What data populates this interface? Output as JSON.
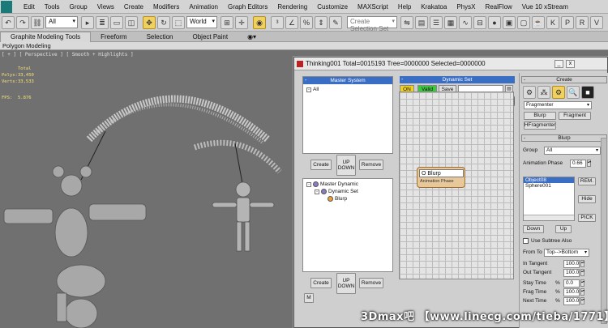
{
  "menu": [
    "Edit",
    "Tools",
    "Group",
    "Views",
    "Create",
    "Modifiers",
    "Animation",
    "Graph Editors",
    "Rendering",
    "Customize",
    "MAXScript",
    "Help",
    "Krakatoa",
    "PhysX",
    "RealFlow",
    "Vue 10 xStream"
  ],
  "toolbar": {
    "selection_filter": "All",
    "ref_coord": "World",
    "selection_set_placeholder": "Create Selection Set"
  },
  "ribbon": {
    "tabs": [
      "Graphite Modeling Tools",
      "Freeform",
      "Selection",
      "Object Paint"
    ],
    "active": "Graphite Modeling Tools",
    "sub_label": "Polygon Modeling"
  },
  "viewport": {
    "label": "[ + ] [ Perspective ] [ Smooth + Highlights ]",
    "stats_title": "Total",
    "polys_label": "Polys:",
    "polys_value": "33,450",
    "verts_label": "Verts:",
    "verts_value": "33,533",
    "fps_label": "FPS:",
    "fps_value": "5.876"
  },
  "dialog": {
    "title": "Thinking001  Total=0015193  Tree=0000000  Selected=0000000",
    "minimize": "_",
    "close": "x",
    "master_system": {
      "header": "Master System",
      "items": [
        "All"
      ],
      "create": "Create",
      "up": "UP",
      "down": "DOWN",
      "remove": "Remove"
    },
    "dynamic_set": {
      "header": "Dynamic Set",
      "on": "ON",
      "valid": "Valid",
      "save": "Save",
      "node_title": "O Blurp",
      "node_sub": "Animation Phase"
    },
    "tree": {
      "items": [
        "Master Dynamic",
        "Dynamic Set",
        "Blurp"
      ],
      "create": "Create",
      "up": "UP",
      "down": "DOWN",
      "remove": "Remove",
      "m_btn": "M"
    }
  },
  "command_panel": {
    "create_rollout": "Create",
    "fragmenter_dd": "Fragmenter",
    "blurp_btn": "Blurp",
    "fragment_btn": "Fragment",
    "hfragmenter_btn": "HFragmenter",
    "blurp_rollout": "Blurp",
    "group_label": "Group",
    "group_value": "All",
    "anim_phase_label": "Animation Phase",
    "anim_phase_value": "0.66",
    "objects": [
      "Object08",
      "Sphere001"
    ],
    "rem_btn": "REM.",
    "hide_btn": "Hide",
    "pick_btn": "PICK",
    "down_btn": "Down",
    "up_btn": "Up",
    "use_subtree": "Use Subtree Also",
    "from_to_label": "From To",
    "from_to_value": "Top-->Bottom",
    "in_tangent_label": "In Tangent",
    "in_tangent_value": "100.0",
    "out_tangent_label": "Out Tangent",
    "out_tangent_value": "100.0",
    "stay_time_label": "Stay Time",
    "stay_time_value": "0.0",
    "frag_time_label": "Frag Time",
    "frag_time_value": "100.0",
    "next_time_label": "Next Time",
    "next_time_value": "100.0",
    "pct": "%"
  },
  "watermark": "3Dmax吧  【www.linecg.com/tieba/1771】"
}
